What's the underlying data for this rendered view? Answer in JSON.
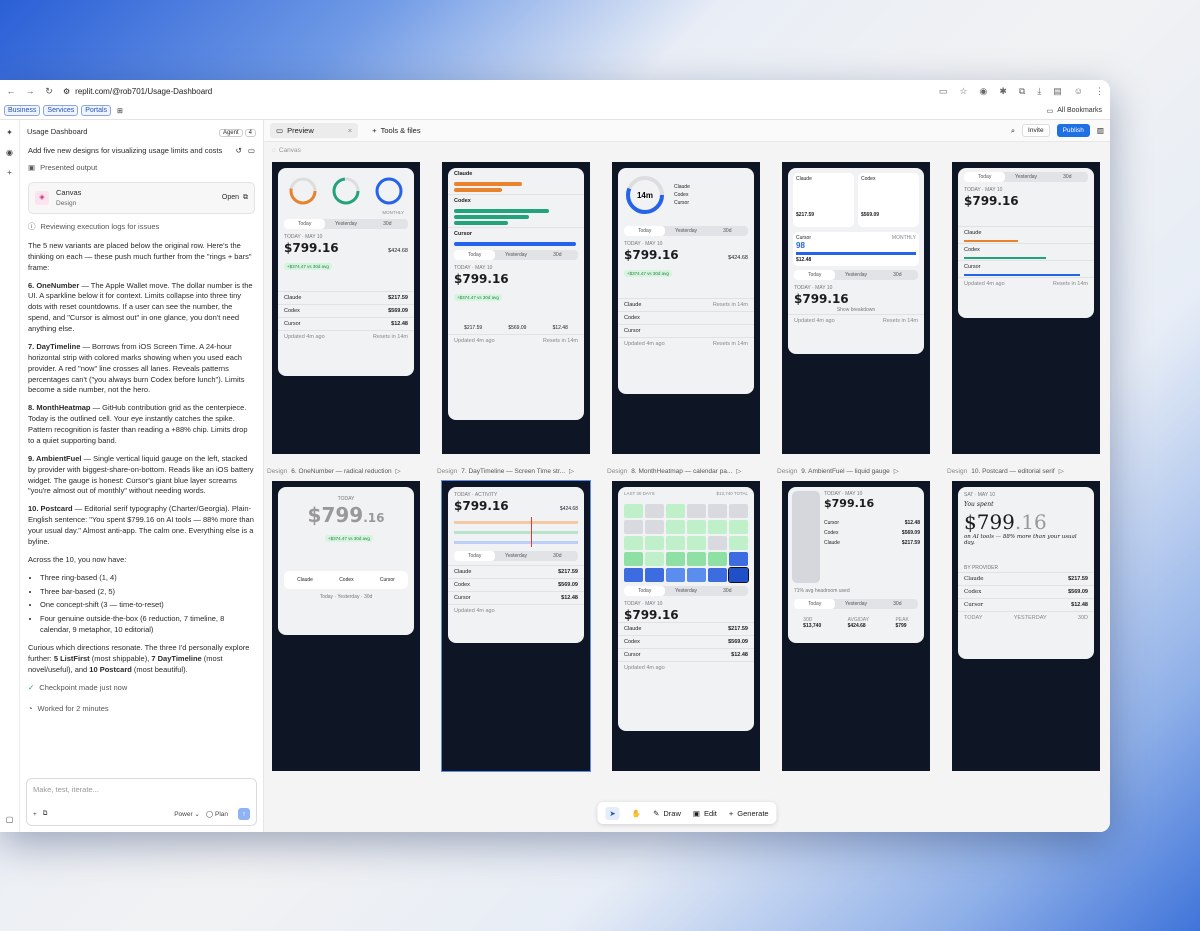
{
  "browser": {
    "url": "replit.com/@rob701/Usage-Dashboard",
    "bookmarks": [
      "Business",
      "Services",
      "Portals"
    ],
    "all_bookmarks": "All Bookmarks"
  },
  "chat": {
    "title": "Usage Dashboard",
    "agent_label": "Agent",
    "agent_count": "4",
    "prompt": "Add five new designs for visualizing usage limits and costs",
    "presented": "Presented output",
    "canvas_card": {
      "title": "Canvas",
      "subtitle": "Design",
      "open": "Open"
    },
    "reviewing": "Reviewing execution logs for issues",
    "intro": "The 5 new variants are placed below the original row. Here's the thinking on each — these push much further from the \"rings + bars\" frame:",
    "items": [
      {
        "head": "6. OneNumber",
        "text": " — The Apple Wallet move. The dollar number is the UI. A sparkline below it for context. Limits collapse into three tiny dots with reset countdowns. If a user can see the number, the spend, and \"Cursor is almost out\" in one glance, you don't need anything else."
      },
      {
        "head": "7. DayTimeline",
        "text": " — Borrows from iOS Screen Time. A 24-hour horizontal strip with colored marks showing when you used each provider. A red \"now\" line crosses all lanes. Reveals patterns percentages can't (\"you always burn Codex before lunch\"). Limits become a side number, not the hero."
      },
      {
        "head": "8. MonthHeatmap",
        "text": " — GitHub contribution grid as the centerpiece. Today is the outlined cell. Your eye instantly catches the spike. Pattern recognition is faster than reading a +88% chip. Limits drop to a quiet supporting band."
      },
      {
        "head": "9. AmbientFuel",
        "text": " — Single vertical liquid gauge on the left, stacked by provider with biggest-share-on-bottom. Reads like an iOS battery widget. The gauge is honest: Cursor's giant blue layer screams \"you're almost out of monthly\" without needing words."
      },
      {
        "head": "10. Postcard",
        "text": " — Editorial serif typography (Charter/Georgia). Plain-English sentence: \"You spent $799.16 on AI tools — 88% more than your usual day.\" Almost anti-app. The calm one. Everything else is a byline."
      }
    ],
    "across": "Across the 10, you now have:",
    "bullets": [
      "Three ring-based (1, 4)",
      "Three bar-based (2, 5)",
      "One concept-shift (3 — time-to-reset)",
      "Four genuine outside-the-box (6 reduction, 7 timeline, 8 calendar, 9 metaphor, 10 editorial)"
    ],
    "closing_pre": "Curious which directions resonate. The three I'd personally explore further: ",
    "closing_b1": "5 ListFirst",
    "closing_m1": " (most shippable), ",
    "closing_b2": "7 DayTimeline",
    "closing_m2": " (most novel/useful), and ",
    "closing_b3": "10 Postcard",
    "closing_end": " (most beautiful).",
    "checkpoint": "Checkpoint made just now",
    "worked": "Worked for 2 minutes",
    "input_placeholder": "Make, test, iterate...",
    "power": "Power",
    "plan": "Plan"
  },
  "preview": {
    "tab_preview": "Preview",
    "tab_tools": "Tools & files",
    "invite": "Invite",
    "publish": "Publish",
    "canvas_label": "Canvas"
  },
  "frames": {
    "design_tag": "Design",
    "labels": [
      "6. OneNumber — radical reduction",
      "7. DayTimeline — Screen Time str...",
      "8. MonthHeatmap — calendar pa...",
      "9. AmbientFuel — liquid gauge",
      "10. Postcard — editorial serif"
    ],
    "amount": "$799.16",
    "amount_whole": "$799",
    "amount_cents": ".16",
    "today_label": "TODAY · MAY 10",
    "avg_label": "30D AVG/DAY",
    "avg_value": "$424.68",
    "chip": "+$374.47 vs 30d avg",
    "seg": [
      "Today",
      "Yesterday",
      "30d"
    ],
    "providers": [
      {
        "name": "Claude",
        "value": "$217.59"
      },
      {
        "name": "Codex",
        "value": "$569.09"
      },
      {
        "name": "Cursor",
        "value": "$12.48"
      }
    ],
    "updated": "Updated 4m ago",
    "resets": "Resets in 14m",
    "next_reset": "NEXT RESET",
    "next_reset_time": "14m",
    "monthly": "MONTHLY",
    "cursor_pct": "98",
    "show_breakdown": "Show breakdown",
    "last30": "LAST 30 DAYS",
    "total": "$13,740 TOTAL",
    "fuel_note": "71% avg headroom used",
    "fuel_stats": [
      {
        "label": "30D",
        "value": "$13,740"
      },
      {
        "label": "AVG/DAY",
        "value": "$424.68"
      },
      {
        "label": "PEAK",
        "value": "$799"
      }
    ],
    "postcard_date": "SAT · MAY 10",
    "postcard_spent": "You spent",
    "postcard_line": "on AI tools — 88% more than your usual day.",
    "by_provider": "BY PROVIDER",
    "postcard_foot": [
      "TODAY",
      "YESTERDAY",
      "30D"
    ]
  },
  "toolbar": {
    "draw": "Draw",
    "edit": "Edit",
    "generate": "Generate"
  },
  "colors": {
    "accent": "#1f6fe5",
    "claude": "#e8822d",
    "codex": "#23a37a",
    "cursor": "#2563eb",
    "canvas_dark": "#0e1626"
  }
}
